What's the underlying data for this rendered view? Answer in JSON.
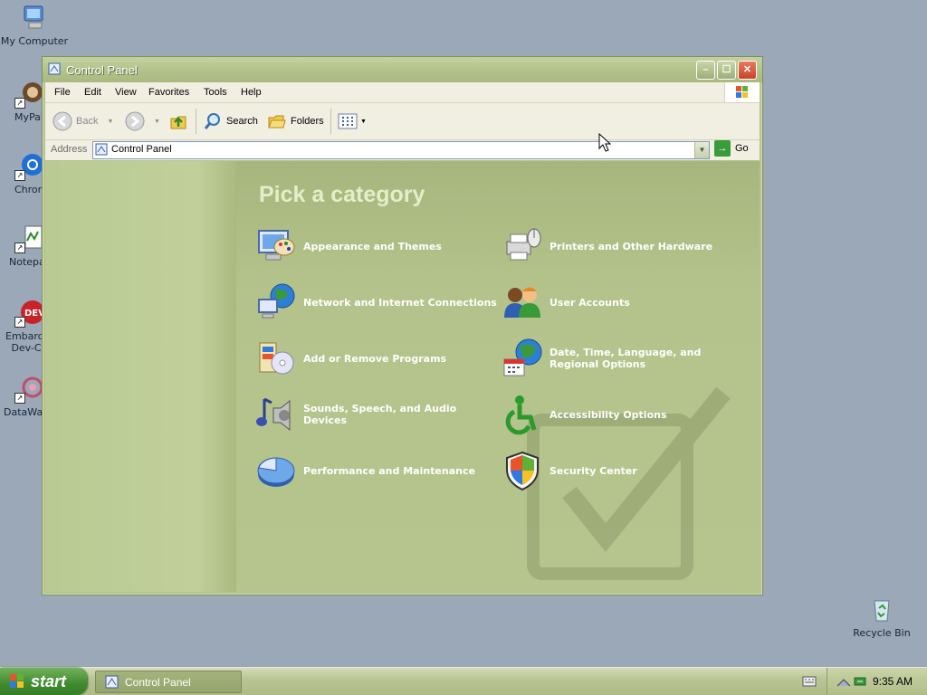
{
  "desktop": {
    "icons": [
      {
        "label": "My Computer"
      },
      {
        "label": "MyPal"
      },
      {
        "label": "Chrom"
      },
      {
        "label": "Notepa"
      },
      {
        "label": "Embarca Dev-C"
      },
      {
        "label": "DataWag"
      },
      {
        "label": "Recycle Bin"
      }
    ]
  },
  "window": {
    "title": "Control Panel",
    "menu": [
      "File",
      "Edit",
      "View",
      "Favorites",
      "Tools",
      "Help"
    ],
    "toolbar": {
      "back": "Back",
      "search": "Search",
      "folders": "Folders"
    },
    "address": {
      "label": "Address",
      "value": "Control Panel",
      "go": "Go"
    },
    "heading": "Pick a category",
    "categories": [
      {
        "label": "Appearance and Themes",
        "icon": "appearance-icon"
      },
      {
        "label": "Printers and Other Hardware",
        "icon": "printer-icon"
      },
      {
        "label": "Network and Internet Connections",
        "icon": "network-icon"
      },
      {
        "label": "User Accounts",
        "icon": "users-icon"
      },
      {
        "label": "Add or Remove Programs",
        "icon": "programs-icon"
      },
      {
        "label": "Date, Time, Language, and Regional Options",
        "icon": "globe-calendar-icon"
      },
      {
        "label": "Sounds, Speech, and Audio Devices",
        "icon": "sound-icon"
      },
      {
        "label": "Accessibility Options",
        "icon": "accessibility-icon"
      },
      {
        "label": "Performance and Maintenance",
        "icon": "performance-icon"
      },
      {
        "label": "Security Center",
        "icon": "shield-icon"
      }
    ]
  },
  "taskbar": {
    "start": "start",
    "task": "Control Panel",
    "clock": "9:35 AM"
  }
}
